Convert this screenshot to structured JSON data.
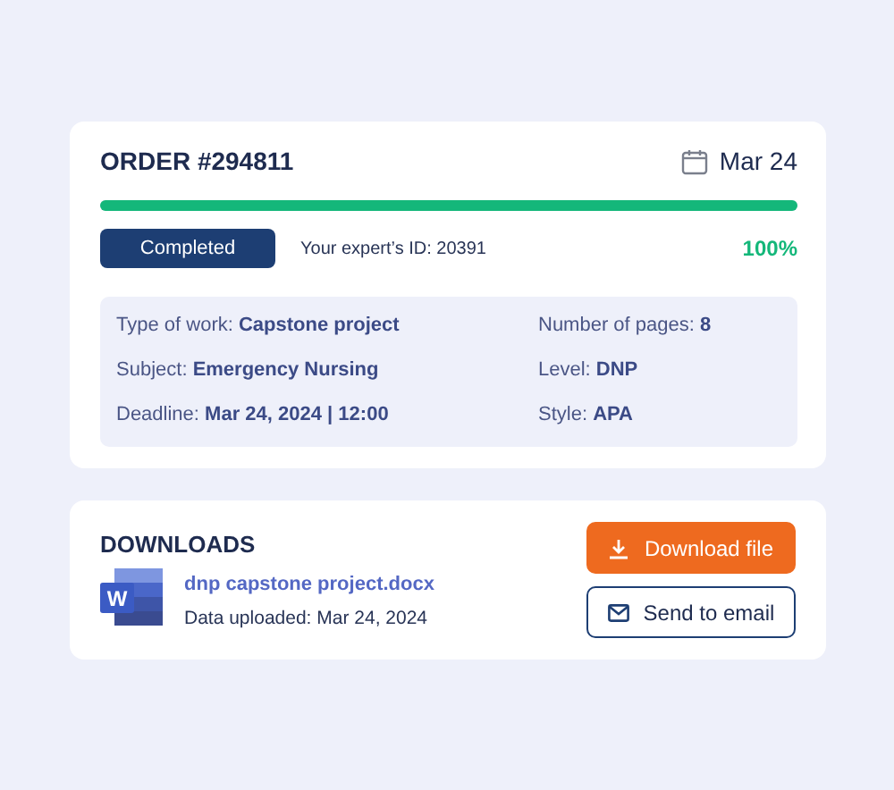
{
  "order": {
    "title": "ORDER #294811",
    "date": "Mar 24",
    "progress": {
      "level": 1.0
    },
    "status": "Completed",
    "expert_id": "Your expert’s ID: 20391",
    "percent": "100%",
    "details": [
      {
        "text": "Type of work: **Capstone project**"
      },
      {
        "text": "Number of pages: **8**"
      },
      {
        "text": "Subject: **Emergency Nursing**"
      },
      {
        "text": "Level: **DNP**"
      },
      {
        "text": "Deadline: **Mar 24, 2024 | 12:00**"
      },
      {
        "text": "Style: **APA**"
      }
    ]
  },
  "downloads": {
    "title": "DOWNLOADS",
    "file_icon_letter": "W",
    "file_name": "dnp capstone project.docx",
    "uploaded": "Data uploaded: Mar 24, 2024",
    "buttons": [
      {
        "kind": "download",
        "label": "Download file"
      },
      {
        "kind": "email",
        "label": "Send to email"
      }
    ]
  }
}
